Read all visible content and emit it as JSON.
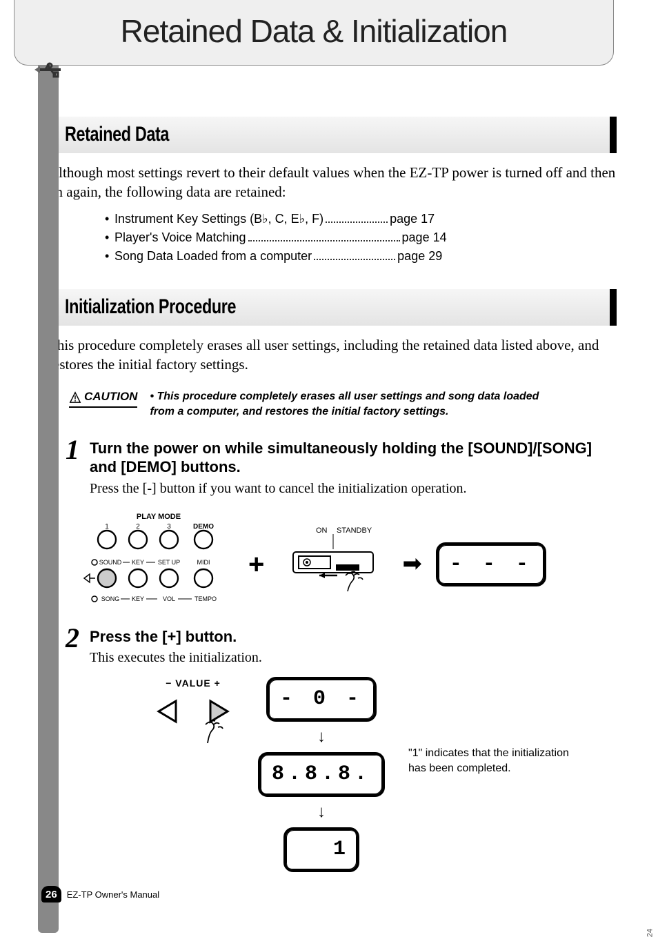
{
  "header": {
    "title": "Retained Data & Initialization"
  },
  "section1": {
    "title": "Retained Data",
    "intro": "Although most settings revert to their default values when the EZ-TP power is turned off and then on again, the following data are retained:",
    "items": [
      {
        "label": "Instrument Key Settings (B♭, C, E♭, F)",
        "page": "page 17"
      },
      {
        "label": "Player's Voice Matching",
        "page": "page 14"
      },
      {
        "label": "Song Data Loaded from a computer",
        "page": "page 29"
      }
    ]
  },
  "section2": {
    "title": "Initialization Procedure",
    "intro": "This procedure completely erases all user settings, including the retained data listed above, and restores the initial factory settings.",
    "caution_label": "CAUTION",
    "caution_text": "• This procedure completely erases all user settings and song data loaded from a computer, and restores the initial factory settings.",
    "step1_num": "1",
    "step1_title": "Turn the power on while simultaneously holding the [SOUND]/[SONG] and [DEMO] buttons.",
    "step1_text": "Press the [-] button if you want to cancel the initialization operation.",
    "panel": {
      "play_mode": "PLAY MODE",
      "n1": "1",
      "n2": "2",
      "n3": "3",
      "demo": "DEMO",
      "sound": "SOUND",
      "key": "KEY",
      "setup": "SET UP",
      "midi": "MIDI",
      "song": "SONG",
      "key2": "KEY",
      "vol": "VOL",
      "tempo": "TEMPO"
    },
    "switch": {
      "on": "ON",
      "standby": "STANDBY"
    },
    "display1": "- - -",
    "step2_num": "2",
    "step2_title": "Press the [+] button.",
    "step2_text": "This executes the initialization.",
    "value_label": "−  VALUE  +",
    "display_seq": {
      "a": "- 0 -",
      "b": "8.8.8.",
      "c": "1"
    },
    "note": "\"1\" indicates that the initialization has been completed."
  },
  "footer": {
    "page": "26",
    "manual": "EZ-TP  Owner's Manual",
    "side": "24"
  }
}
